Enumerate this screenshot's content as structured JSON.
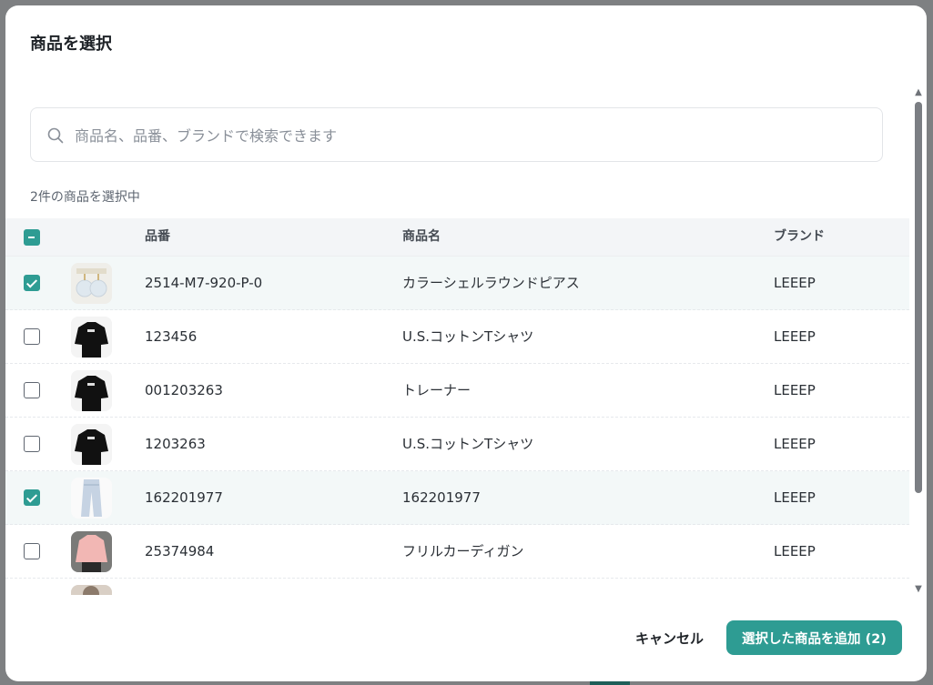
{
  "modal": {
    "title": "商品を選択",
    "search": {
      "placeholder": "商品名、品番、ブランドで検索できます",
      "value": ""
    },
    "selected_count_text": "2件の商品を選択中",
    "table": {
      "columns": {
        "sku": "品番",
        "name": "商品名",
        "brand": "ブランド"
      },
      "header_checkbox_state": "indeterminate",
      "rows": [
        {
          "sku": "2514-M7-920-P-0",
          "name": "カラーシェルラウンドピアス",
          "brand": "LEEEP",
          "checked": true,
          "thumb": "earrings-icon"
        },
        {
          "sku": "123456",
          "name": "U.S.コットンTシャツ",
          "brand": "LEEEP",
          "checked": false,
          "thumb": "black-shirt-icon"
        },
        {
          "sku": "001203263",
          "name": "トレーナー",
          "brand": "LEEEP",
          "checked": false,
          "thumb": "black-shirt-icon"
        },
        {
          "sku": "1203263",
          "name": "U.S.コットンTシャツ",
          "brand": "LEEEP",
          "checked": false,
          "thumb": "black-shirt-icon"
        },
        {
          "sku": "162201977",
          "name": "162201977",
          "brand": "LEEEP",
          "checked": true,
          "thumb": "jeans-icon"
        },
        {
          "sku": "25374984",
          "name": "フリルカーディガン",
          "brand": "LEEEP",
          "checked": false,
          "thumb": "pink-cardigan-icon"
        },
        {
          "sku": "",
          "name": "",
          "brand": "",
          "checked": false,
          "thumb": "partial-thumb-icon"
        }
      ]
    },
    "footer": {
      "cancel_label": "キャンセル",
      "add_label": "選択した商品を追加 (2)"
    }
  },
  "colors": {
    "accent": "#2e9c93",
    "overlay": "#7e8082"
  }
}
